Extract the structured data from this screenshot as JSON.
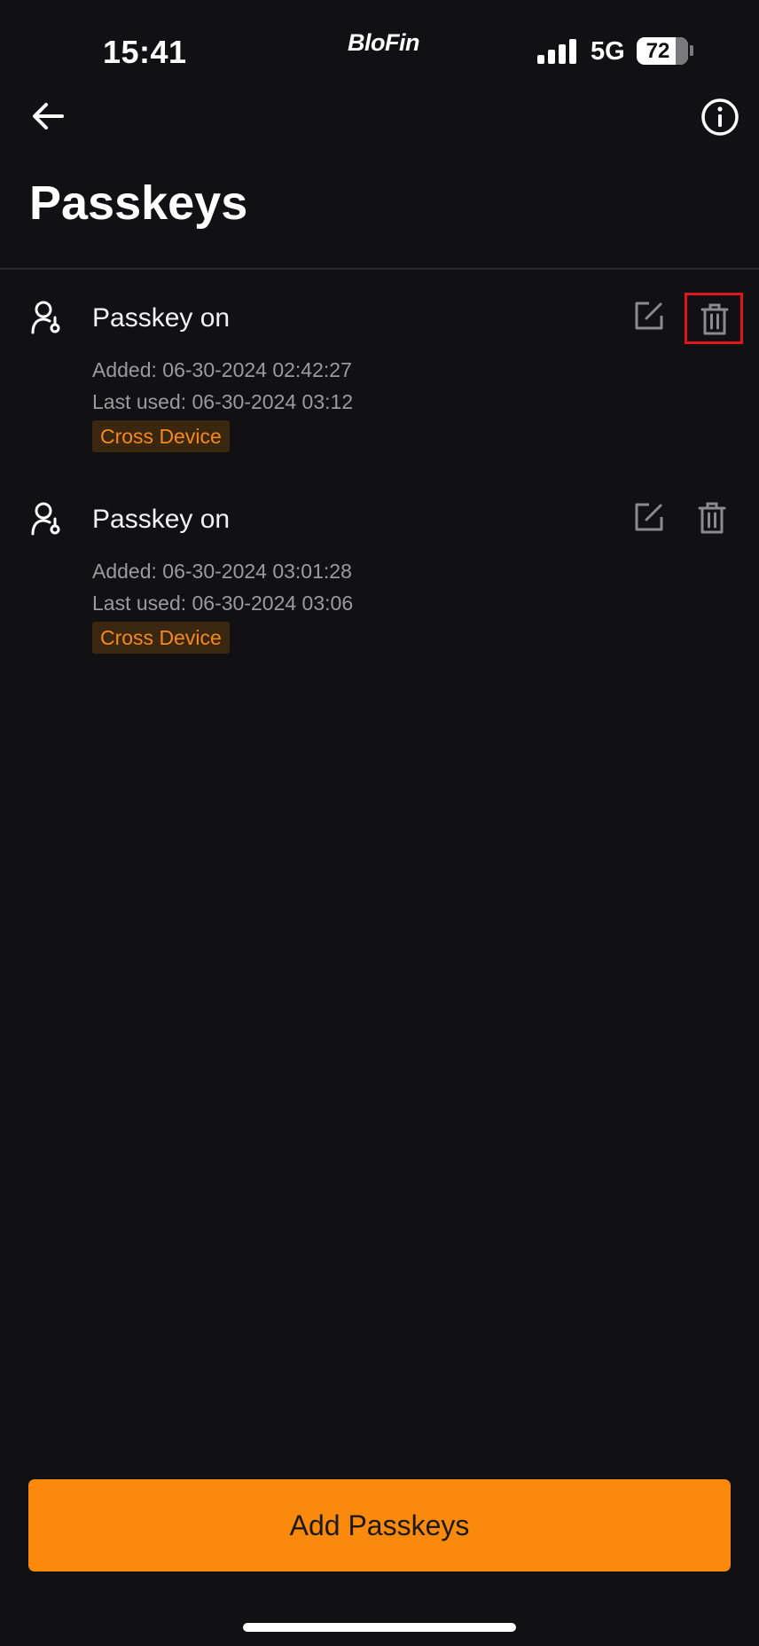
{
  "status_bar": {
    "time": "15:41",
    "brand": "BloFin",
    "network": "5G",
    "battery": "72"
  },
  "header": {
    "back_icon": "arrow-left-icon",
    "info_icon": "info-circle-icon",
    "title": "Passkeys"
  },
  "passkeys": [
    {
      "name": "Passkey on",
      "added": "Added: 06-30-2024 02:42:27",
      "last_used": "Last used: 06-30-2024 03:12",
      "tag": "Cross Device"
    },
    {
      "name": "Passkey on",
      "added": "Added: 06-30-2024 03:01:28",
      "last_used": "Last used: 06-30-2024 03:06",
      "tag": "Cross Device"
    }
  ],
  "actions": {
    "add_label": "Add Passkeys"
  },
  "colors": {
    "background": "#111113",
    "accent": "#fb8a0c",
    "tag_text": "#f5891b",
    "tag_bg": "#3b2610",
    "highlight": "#e0161e"
  }
}
